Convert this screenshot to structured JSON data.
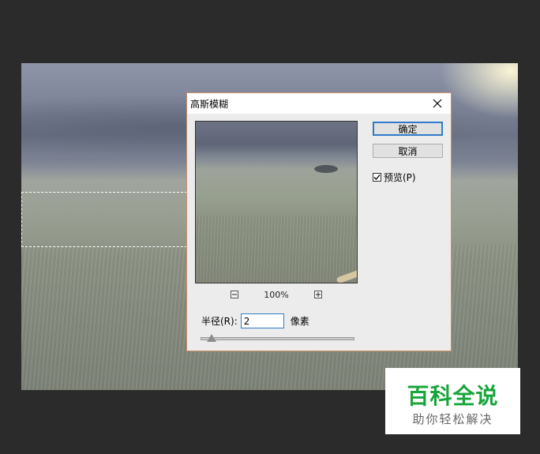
{
  "dialog": {
    "title": "高斯模糊",
    "ok_label": "确定",
    "cancel_label": "取消",
    "preview_label": "预览(P)",
    "preview_checked": true,
    "zoom_level": "100%",
    "radius_label": "半径(R):",
    "radius_value": "2",
    "radius_unit": "像素",
    "radius_slider_fraction": 0.07
  },
  "watermark": {
    "main": "百科全说",
    "sub": "助你轻松解决"
  },
  "colors": {
    "accent": "#2f7bc9",
    "dialog_border": "#cf8f68",
    "watermark_green": "#19a53b",
    "app_bg": "#2b2b2b"
  }
}
